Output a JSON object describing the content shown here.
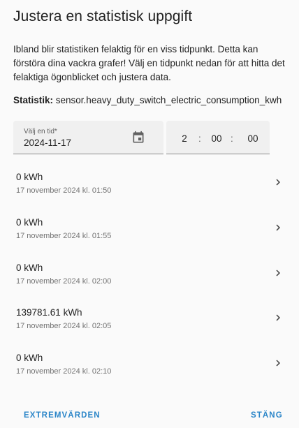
{
  "dialog": {
    "title": "Justera en statistisk uppgift",
    "description": "Ibland blir statistiken felaktig för en viss tidpunkt. Detta kan förstöra dina vackra grafer! Välj en tidpunkt nedan för att hitta det felaktiga ögonblicket och justera data.",
    "statistic_label": "Statistik:",
    "statistic_value": "sensor.heavy_duty_switch_electric_consumption_kwh"
  },
  "date_picker": {
    "label": "Välj en tid*",
    "value": "2024-11-17",
    "icon": "calendar-icon"
  },
  "time_picker": {
    "hours": "2",
    "minutes": "00",
    "seconds": "00",
    "separator": ":"
  },
  "rows": [
    {
      "value": "0 kWh",
      "timestamp": "17 november 2024 kl. 01:50"
    },
    {
      "value": "0 kWh",
      "timestamp": "17 november 2024 kl. 01:55"
    },
    {
      "value": "0 kWh",
      "timestamp": "17 november 2024 kl. 02:00"
    },
    {
      "value": "139781.61 kWh",
      "timestamp": "17 november 2024 kl. 02:05"
    },
    {
      "value": "0 kWh",
      "timestamp": "17 november 2024 kl. 02:10"
    }
  ],
  "actions": {
    "extremes_label": "EXTREMVÄRDEN",
    "close_label": "STÄNG"
  },
  "colors": {
    "accent": "#2a85c8",
    "field_bg": "#f0f0f0",
    "dialog_bg": "#fafafa"
  }
}
